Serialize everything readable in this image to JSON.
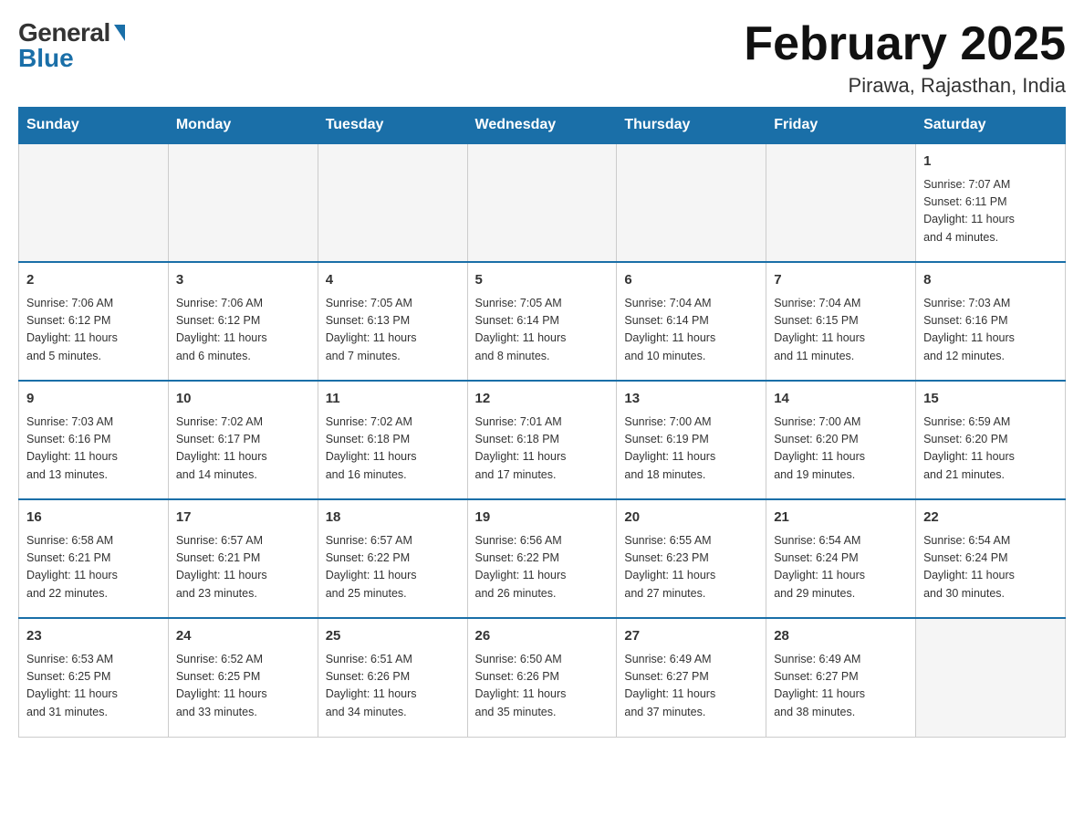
{
  "logo": {
    "general": "General",
    "blue": "Blue"
  },
  "title": "February 2025",
  "subtitle": "Pirawa, Rajasthan, India",
  "days_of_week": [
    "Sunday",
    "Monday",
    "Tuesday",
    "Wednesday",
    "Thursday",
    "Friday",
    "Saturday"
  ],
  "weeks": [
    [
      {
        "day": "",
        "info": ""
      },
      {
        "day": "",
        "info": ""
      },
      {
        "day": "",
        "info": ""
      },
      {
        "day": "",
        "info": ""
      },
      {
        "day": "",
        "info": ""
      },
      {
        "day": "",
        "info": ""
      },
      {
        "day": "1",
        "info": "Sunrise: 7:07 AM\nSunset: 6:11 PM\nDaylight: 11 hours\nand 4 minutes."
      }
    ],
    [
      {
        "day": "2",
        "info": "Sunrise: 7:06 AM\nSunset: 6:12 PM\nDaylight: 11 hours\nand 5 minutes."
      },
      {
        "day": "3",
        "info": "Sunrise: 7:06 AM\nSunset: 6:12 PM\nDaylight: 11 hours\nand 6 minutes."
      },
      {
        "day": "4",
        "info": "Sunrise: 7:05 AM\nSunset: 6:13 PM\nDaylight: 11 hours\nand 7 minutes."
      },
      {
        "day": "5",
        "info": "Sunrise: 7:05 AM\nSunset: 6:14 PM\nDaylight: 11 hours\nand 8 minutes."
      },
      {
        "day": "6",
        "info": "Sunrise: 7:04 AM\nSunset: 6:14 PM\nDaylight: 11 hours\nand 10 minutes."
      },
      {
        "day": "7",
        "info": "Sunrise: 7:04 AM\nSunset: 6:15 PM\nDaylight: 11 hours\nand 11 minutes."
      },
      {
        "day": "8",
        "info": "Sunrise: 7:03 AM\nSunset: 6:16 PM\nDaylight: 11 hours\nand 12 minutes."
      }
    ],
    [
      {
        "day": "9",
        "info": "Sunrise: 7:03 AM\nSunset: 6:16 PM\nDaylight: 11 hours\nand 13 minutes."
      },
      {
        "day": "10",
        "info": "Sunrise: 7:02 AM\nSunset: 6:17 PM\nDaylight: 11 hours\nand 14 minutes."
      },
      {
        "day": "11",
        "info": "Sunrise: 7:02 AM\nSunset: 6:18 PM\nDaylight: 11 hours\nand 16 minutes."
      },
      {
        "day": "12",
        "info": "Sunrise: 7:01 AM\nSunset: 6:18 PM\nDaylight: 11 hours\nand 17 minutes."
      },
      {
        "day": "13",
        "info": "Sunrise: 7:00 AM\nSunset: 6:19 PM\nDaylight: 11 hours\nand 18 minutes."
      },
      {
        "day": "14",
        "info": "Sunrise: 7:00 AM\nSunset: 6:20 PM\nDaylight: 11 hours\nand 19 minutes."
      },
      {
        "day": "15",
        "info": "Sunrise: 6:59 AM\nSunset: 6:20 PM\nDaylight: 11 hours\nand 21 minutes."
      }
    ],
    [
      {
        "day": "16",
        "info": "Sunrise: 6:58 AM\nSunset: 6:21 PM\nDaylight: 11 hours\nand 22 minutes."
      },
      {
        "day": "17",
        "info": "Sunrise: 6:57 AM\nSunset: 6:21 PM\nDaylight: 11 hours\nand 23 minutes."
      },
      {
        "day": "18",
        "info": "Sunrise: 6:57 AM\nSunset: 6:22 PM\nDaylight: 11 hours\nand 25 minutes."
      },
      {
        "day": "19",
        "info": "Sunrise: 6:56 AM\nSunset: 6:22 PM\nDaylight: 11 hours\nand 26 minutes."
      },
      {
        "day": "20",
        "info": "Sunrise: 6:55 AM\nSunset: 6:23 PM\nDaylight: 11 hours\nand 27 minutes."
      },
      {
        "day": "21",
        "info": "Sunrise: 6:54 AM\nSunset: 6:24 PM\nDaylight: 11 hours\nand 29 minutes."
      },
      {
        "day": "22",
        "info": "Sunrise: 6:54 AM\nSunset: 6:24 PM\nDaylight: 11 hours\nand 30 minutes."
      }
    ],
    [
      {
        "day": "23",
        "info": "Sunrise: 6:53 AM\nSunset: 6:25 PM\nDaylight: 11 hours\nand 31 minutes."
      },
      {
        "day": "24",
        "info": "Sunrise: 6:52 AM\nSunset: 6:25 PM\nDaylight: 11 hours\nand 33 minutes."
      },
      {
        "day": "25",
        "info": "Sunrise: 6:51 AM\nSunset: 6:26 PM\nDaylight: 11 hours\nand 34 minutes."
      },
      {
        "day": "26",
        "info": "Sunrise: 6:50 AM\nSunset: 6:26 PM\nDaylight: 11 hours\nand 35 minutes."
      },
      {
        "day": "27",
        "info": "Sunrise: 6:49 AM\nSunset: 6:27 PM\nDaylight: 11 hours\nand 37 minutes."
      },
      {
        "day": "28",
        "info": "Sunrise: 6:49 AM\nSunset: 6:27 PM\nDaylight: 11 hours\nand 38 minutes."
      },
      {
        "day": "",
        "info": ""
      }
    ]
  ]
}
